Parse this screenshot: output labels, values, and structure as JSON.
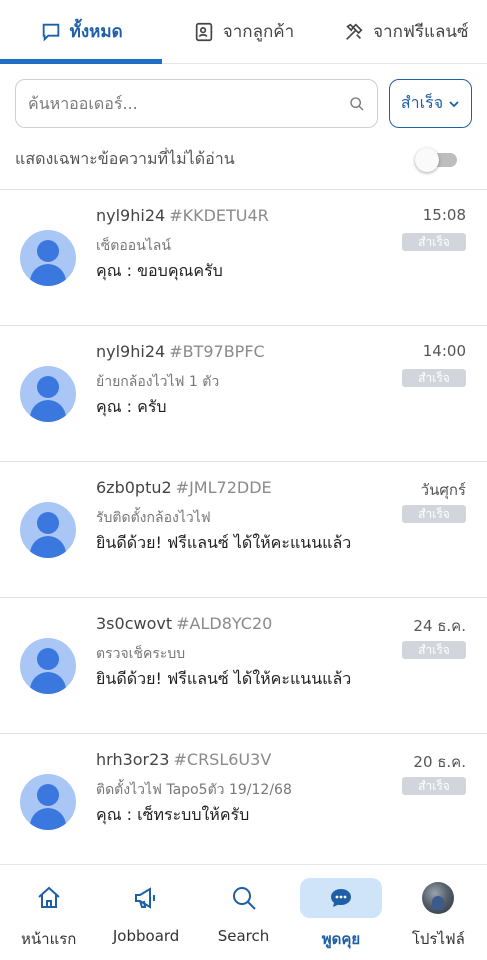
{
  "tabs": [
    {
      "label": "ทั้งหมด",
      "icon": "chat-icon",
      "active": true
    },
    {
      "label": "จากลูกค้า",
      "icon": "contact-card-icon",
      "active": false
    },
    {
      "label": "จากฟรีแลนซ์",
      "icon": "tools-icon",
      "active": false
    }
  ],
  "search": {
    "placeholder": "ค้นหาออเดอร์...",
    "value": ""
  },
  "status_filter": {
    "selected": "สำเร็จ"
  },
  "unread_toggle": {
    "label": "แสดงเฉพาะข้อความที่ไม่ได้อ่าน",
    "on": false
  },
  "conversations": [
    {
      "name": "nyl9hi24",
      "order_id": "#KKDETU4R",
      "time": "15:08",
      "subject": "เซ็ตออนไลน์",
      "status": "สำเร็จ",
      "message": "คุณ : ขอบคุณครับ"
    },
    {
      "name": "nyl9hi24",
      "order_id": "#BT97BPFC",
      "time": "14:00",
      "subject": "ย้ายกล้องไวไฟ 1 ตัว",
      "status": "สำเร็จ",
      "message": "คุณ : ครับ"
    },
    {
      "name": "6zb0ptu2",
      "order_id": "#JML72DDE",
      "time": "วันศุกร์",
      "subject": "รับติดตั้งกล้องไวไฟ",
      "status": "สำเร็จ",
      "message": "ยินดีด้วย! ฟรีแลนซ์ ได้ให้คะแนนแล้ว"
    },
    {
      "name": "3s0cwovt",
      "order_id": "#ALD8YC20",
      "time": "24 ธ.ค.",
      "subject": "ตรวจเช็คระบบ",
      "status": "สำเร็จ",
      "message": "ยินดีด้วย! ฟรีแลนซ์ ได้ให้คะแนนแล้ว"
    },
    {
      "name": "hrh3or23",
      "order_id": "#CRSL6U3V",
      "time": "20 ธ.ค.",
      "subject": "ติดตั้งไวไฟ Tapo5ตัว 19/12/68",
      "status": "สำเร็จ",
      "message": "คุณ : เซ็ทระบบให้ครับ"
    }
  ],
  "bottom_nav": [
    {
      "label": "หน้าแรก",
      "icon": "home-icon",
      "active": false
    },
    {
      "label": "Jobboard",
      "icon": "megaphone-icon",
      "active": false
    },
    {
      "label": "Search",
      "icon": "search-icon",
      "active": false
    },
    {
      "label": "พูดคุย",
      "icon": "chat-bubble-icon",
      "active": true
    },
    {
      "label": "โปรไฟล์",
      "icon": "profile-avatar",
      "active": false
    }
  ],
  "colors": {
    "accent": "#1f5fa8",
    "tab_indicator": "#1f6fc9",
    "badge": "#d2d5db",
    "avatar_bg": "#a9c6f5",
    "avatar_fg": "#3a78e0",
    "nav_active_bg": "#cfe4f9"
  }
}
